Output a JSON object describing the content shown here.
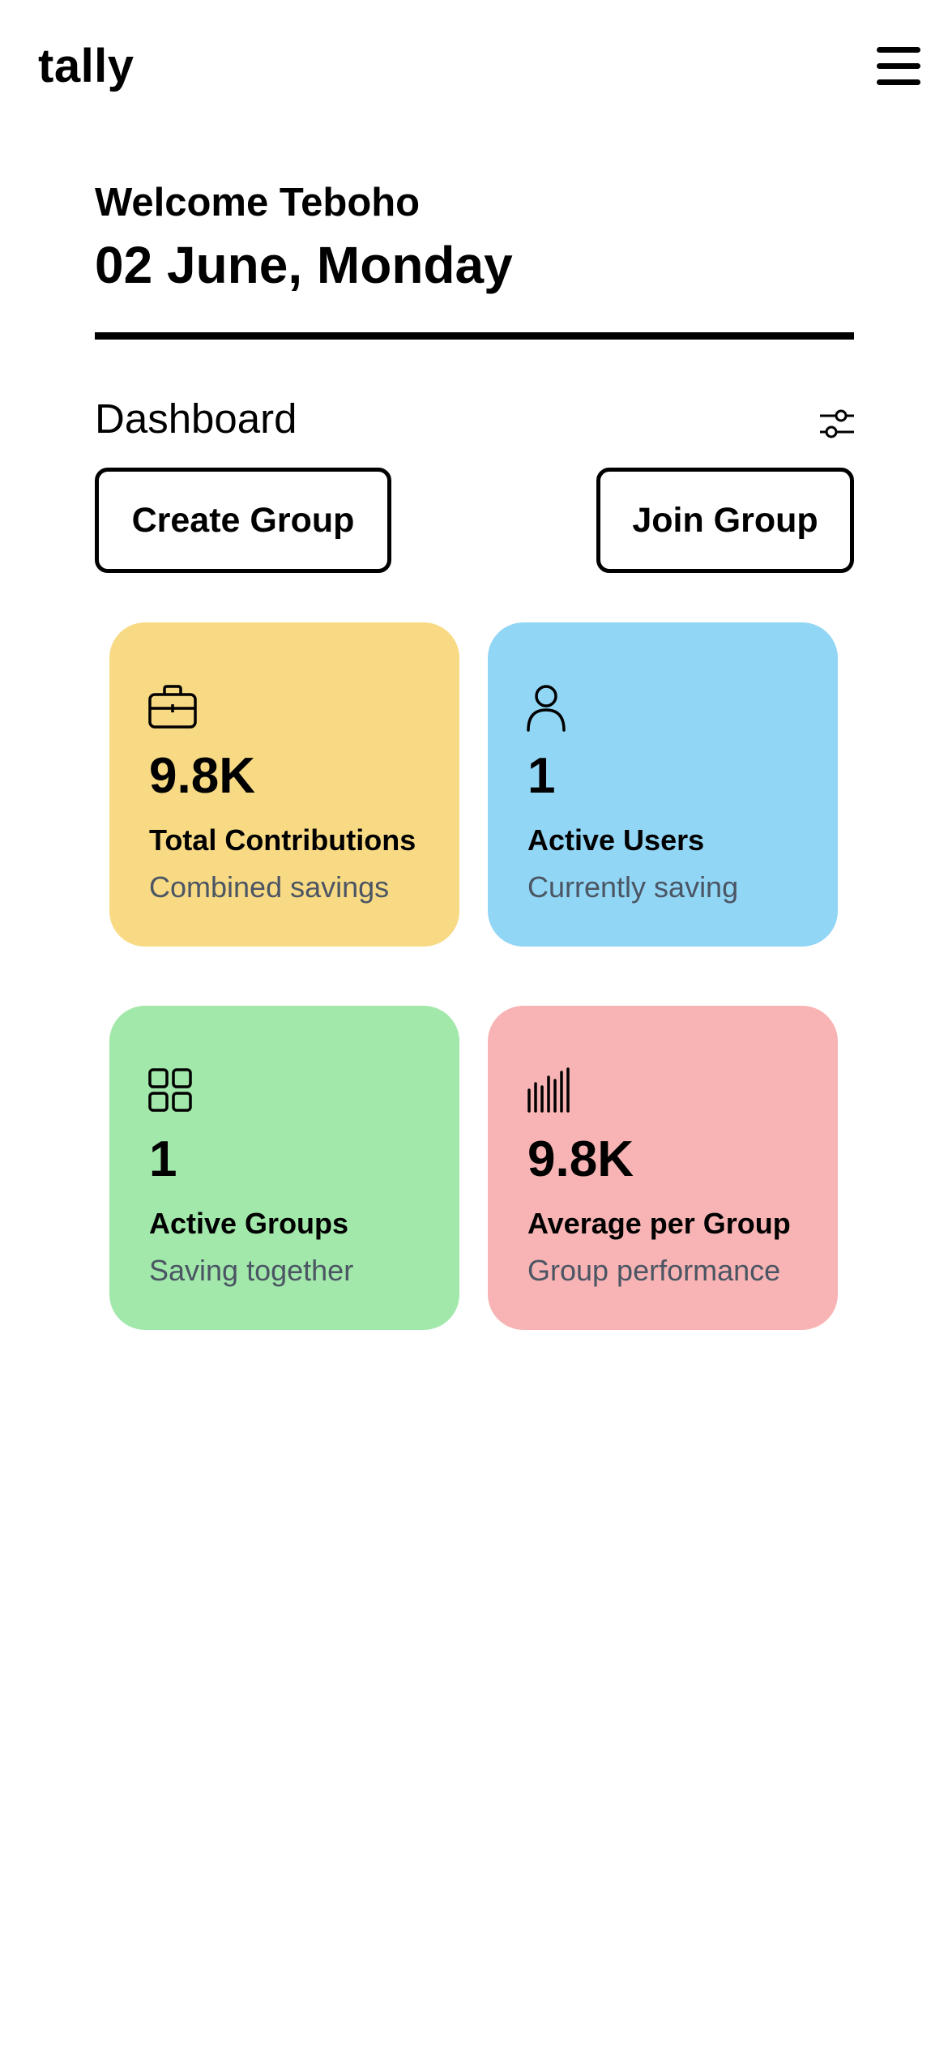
{
  "app": {
    "logo": "tally"
  },
  "header": {
    "welcome": "Welcome Teboho",
    "date": "02 June, Monday"
  },
  "dashboard": {
    "title": "Dashboard",
    "create_label": "Create Group",
    "join_label": "Join Group"
  },
  "cards": [
    {
      "icon": "briefcase-icon",
      "value": "9.8K",
      "label": "Total Contributions",
      "sub": "Combined savings",
      "color": "#F8DA84"
    },
    {
      "icon": "user-icon",
      "value": "1",
      "label": "Active Users",
      "sub": "Currently saving",
      "color": "#91D6F5"
    },
    {
      "icon": "grid-icon",
      "value": "1",
      "label": "Active Groups",
      "sub": "Saving together",
      "color": "#A1E8AA"
    },
    {
      "icon": "bar-chart-icon",
      "value": "9.8K",
      "label": "Average per Group",
      "sub": "Group performance",
      "color": "#F8B4B4"
    }
  ]
}
